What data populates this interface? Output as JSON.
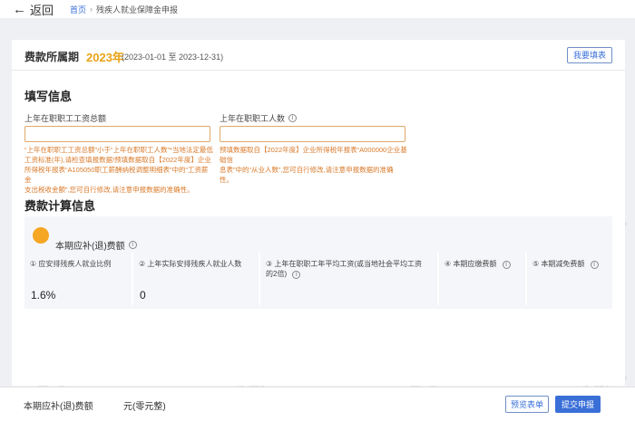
{
  "topbar": {
    "back_label": "返回",
    "breadcrumb_home": "首页",
    "breadcrumb_separator": "›",
    "breadcrumb_current": "残疾人就业保障金申报"
  },
  "period": {
    "label": "费款所属期",
    "year": "2023年",
    "range": "(2023-01-01 至 2023-12-31)",
    "help_button": "我要填表"
  },
  "fill_info": {
    "title": "填写信息",
    "salary_label": "上年在职职工工资总额",
    "salary_value": "",
    "staff_label": "上年在职职工人数",
    "staff_value": "",
    "salary_hint_lines": [
      "“上年在职职工工资总额”小于“上年在职职工人数”*当地法定最低",
      "工资标准(年),请检查填报数据!预填数据取自【2022年度】企业",
      "所得税年报表“A105050职工薪酬纳税调整明细表”中的“工资薪金",
      "支出税收金额”,您可自行修改,请注意申报数据的准确性。"
    ],
    "staff_hint_lines": [
      "预填数据取自【2022年度】企业所得税年报表“A000000企业基础信",
      "息表”中的“从业人数”,您可自行修改,请注意申报数据的准确",
      "性。"
    ]
  },
  "calc": {
    "title": "费款计算信息",
    "due_label": "本期应补(退)费额",
    "metrics": [
      {
        "label": "① 应安排残疾人就业比例",
        "value": "1.6%"
      },
      {
        "label": "② 上年实际安排残疾人就业人数",
        "value": "0"
      },
      {
        "label": "③ 上年在职职工年平均工资(或当地社会平均工资的2倍)",
        "value": ""
      },
      {
        "label": "④ 本期应缴费额",
        "value": ""
      },
      {
        "label": "⑤ 本期减免费额",
        "value": ""
      }
    ]
  },
  "footer": {
    "label": "本期应补(退)费额",
    "amount": "元(零元整)",
    "preview_button": "预览表单",
    "submit_button": "提交申报"
  },
  "watermark": "梅松讲税",
  "colors": {
    "accent": "#3a6fd8",
    "year": "#e8a317",
    "hint": "#d97a2a",
    "dot": "#f5a623"
  }
}
